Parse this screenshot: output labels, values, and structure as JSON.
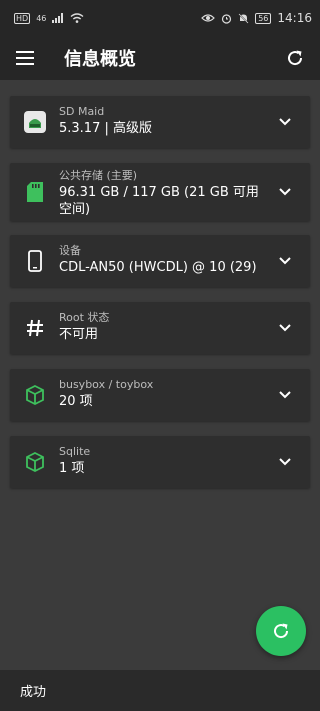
{
  "status_bar": {
    "hd": "HD",
    "signal": "46",
    "battery": "56",
    "time": "14:16"
  },
  "app_bar": {
    "title": "信息概览"
  },
  "cards": [
    {
      "label": "SD Maid",
      "value": "5.3.17 | 高级版"
    },
    {
      "label": "公共存储 (主要)",
      "value": "96.31 GB / 117 GB (21 GB 可用空间)"
    },
    {
      "label": "设备",
      "value": "CDL-AN50 (HWCDL) @ 10 (29)"
    },
    {
      "label": "Root 状态",
      "value": "不可用"
    },
    {
      "label": "busybox / toybox",
      "value": "20 项"
    },
    {
      "label": "Sqlite",
      "value": "1 项"
    }
  ],
  "snackbar": {
    "text": "成功"
  },
  "colors": {
    "accent": "#2bc062",
    "card": "#2e2e2e",
    "background": "#3b3b3b",
    "bar": "#262626"
  }
}
